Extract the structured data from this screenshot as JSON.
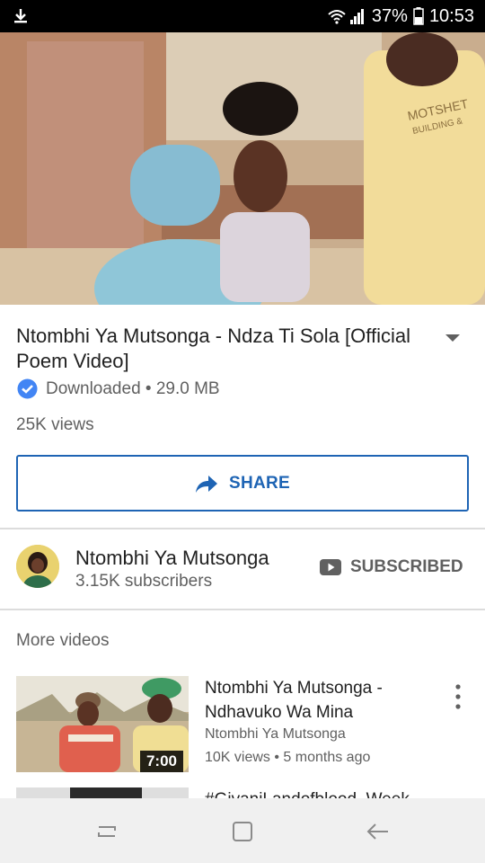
{
  "status_bar": {
    "battery": "37%",
    "time": "10:53",
    "icons": [
      "download-notification-icon",
      "wifi-icon",
      "cell-signal-icon",
      "battery-icon"
    ]
  },
  "video": {
    "title": "Ntombhi Ya Mutsonga - Ndza Ti Sola [Official Poem Video]",
    "download_status": "Downloaded • 29.0 MB",
    "views": "25K views"
  },
  "share": {
    "label": "SHARE"
  },
  "channel": {
    "name": "Ntombhi Ya Mutsonga",
    "subscribers": "3.15K subscribers",
    "subscribe_label": "SUBSCRIBED"
  },
  "more_videos": {
    "label": "More videos",
    "items": [
      {
        "title": "Ntombhi Ya Mutsonga - Ndhavuko Wa Mina",
        "channel": "Ntombhi Ya Mutsonga",
        "meta": "10K views • 5 months ago",
        "duration": "7:00"
      },
      {
        "title": "#GivaniLandofblood_Week"
      }
    ]
  },
  "colors": {
    "accent": "#1e64b4",
    "check_badge": "#4285f4",
    "secondary_text": "#606060",
    "primary_text": "#212121"
  }
}
